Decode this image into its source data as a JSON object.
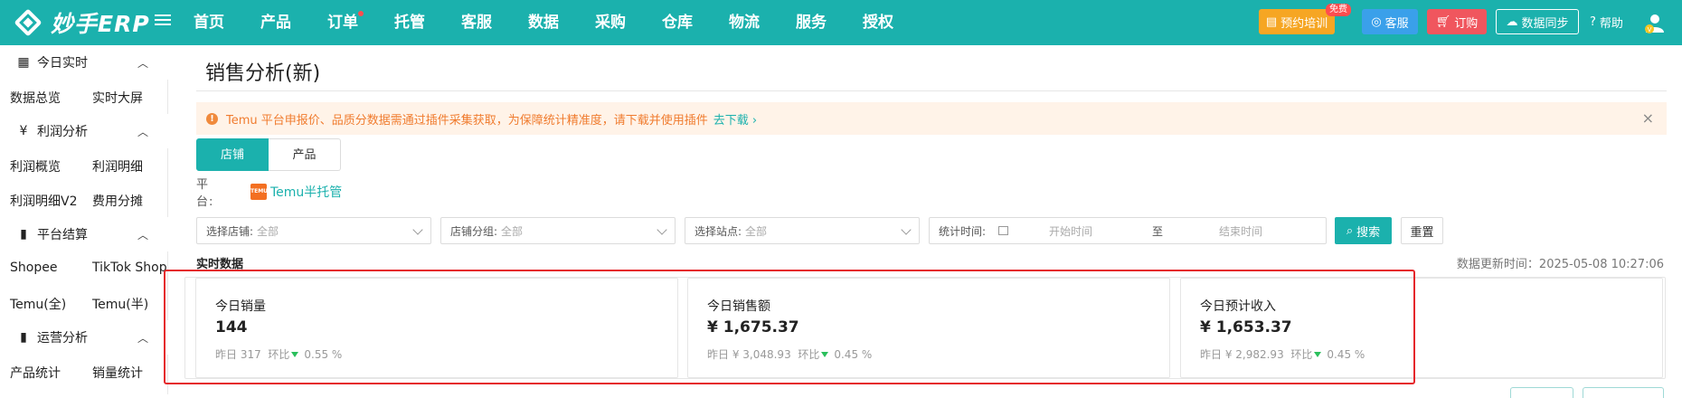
{
  "topbar": {
    "logo_text": "妙手ERP",
    "nav": [
      {
        "label": "首页",
        "dot": false
      },
      {
        "label": "产品",
        "dot": false
      },
      {
        "label": "订单",
        "dot": true
      },
      {
        "label": "托管",
        "dot": false
      },
      {
        "label": "客服",
        "dot": false
      },
      {
        "label": "数据",
        "dot": false
      },
      {
        "label": "采购",
        "dot": false
      },
      {
        "label": "仓库",
        "dot": false
      },
      {
        "label": "物流",
        "dot": false
      },
      {
        "label": "服务",
        "dot": false
      },
      {
        "label": "授权",
        "dot": false
      }
    ],
    "train_label": "预约培训",
    "free_badge": "免费",
    "cs_label": "客服",
    "order_label": "订购",
    "sync_label": "数据同步",
    "help_label": "帮助"
  },
  "sidebar": {
    "groups": [
      {
        "label": "今日实时",
        "icon": "calendar-icon"
      },
      {
        "label": "利润分析",
        "icon": "yen-icon"
      },
      {
        "label": "平台结算",
        "icon": "bar-chart-icon"
      },
      {
        "label": "运营分析",
        "icon": "bar-chart-icon"
      }
    ],
    "items": {
      "today_overview": "数据总览",
      "today_screen": "实时大屏",
      "profit_overview": "利润概览",
      "profit_detail": "利润明细",
      "profit_detail_v2": "利润明细V2",
      "cost_share": "费用分摊",
      "shopee": "Shopee",
      "tiktok": "TikTok Shop",
      "temu_full": "Temu(全)",
      "temu_half": "Temu(半)",
      "product_stats": "产品统计",
      "sales_stats": "销量统计"
    }
  },
  "main": {
    "title": "销售分析(新)",
    "alert": {
      "text": "Temu 平台申报价、品质分数据需通过插件采集获取，为保障统计精准度，请下载并使用插件",
      "link": "去下载 ›",
      "close": "×"
    },
    "tabs": [
      "店铺",
      "产品"
    ],
    "platform_label": "平　　台:",
    "platform_logo": "TEMU",
    "platform_value": "Temu半托管",
    "filters": {
      "store_label": "选择店铺:",
      "store_value": "全部",
      "group_label": "店铺分组:",
      "group_value": "全部",
      "site_label": "选择站点:",
      "site_value": "全部",
      "time_label": "统计时间:",
      "start_placeholder": "开始时间",
      "sep": "至",
      "end_placeholder": "结束时间"
    },
    "search_label": "搜索",
    "reset_label": "重置",
    "section_title": "实时数据",
    "update_time": "数据更新时间：2025-05-08 10:27:06",
    "cards": [
      {
        "title": "今日销量",
        "value": "144",
        "yesterday": "昨日 317",
        "ratio_label": "环比",
        "ratio": "0.55 %"
      },
      {
        "title": "今日销售额",
        "value": "¥ 1,675.37",
        "yesterday": "昨日 ¥ 3,048.93",
        "ratio_label": "环比",
        "ratio": "0.45 %"
      },
      {
        "title": "今日预计收入",
        "value": "¥ 1,653.37",
        "yesterday": "昨日 ¥ 2,982.93",
        "ratio_label": "环比",
        "ratio": "0.45 %"
      }
    ]
  },
  "colors": {
    "brand": "#1bb1ad",
    "highlight": "#e5262b",
    "trend_down": "#2bbf5c"
  }
}
